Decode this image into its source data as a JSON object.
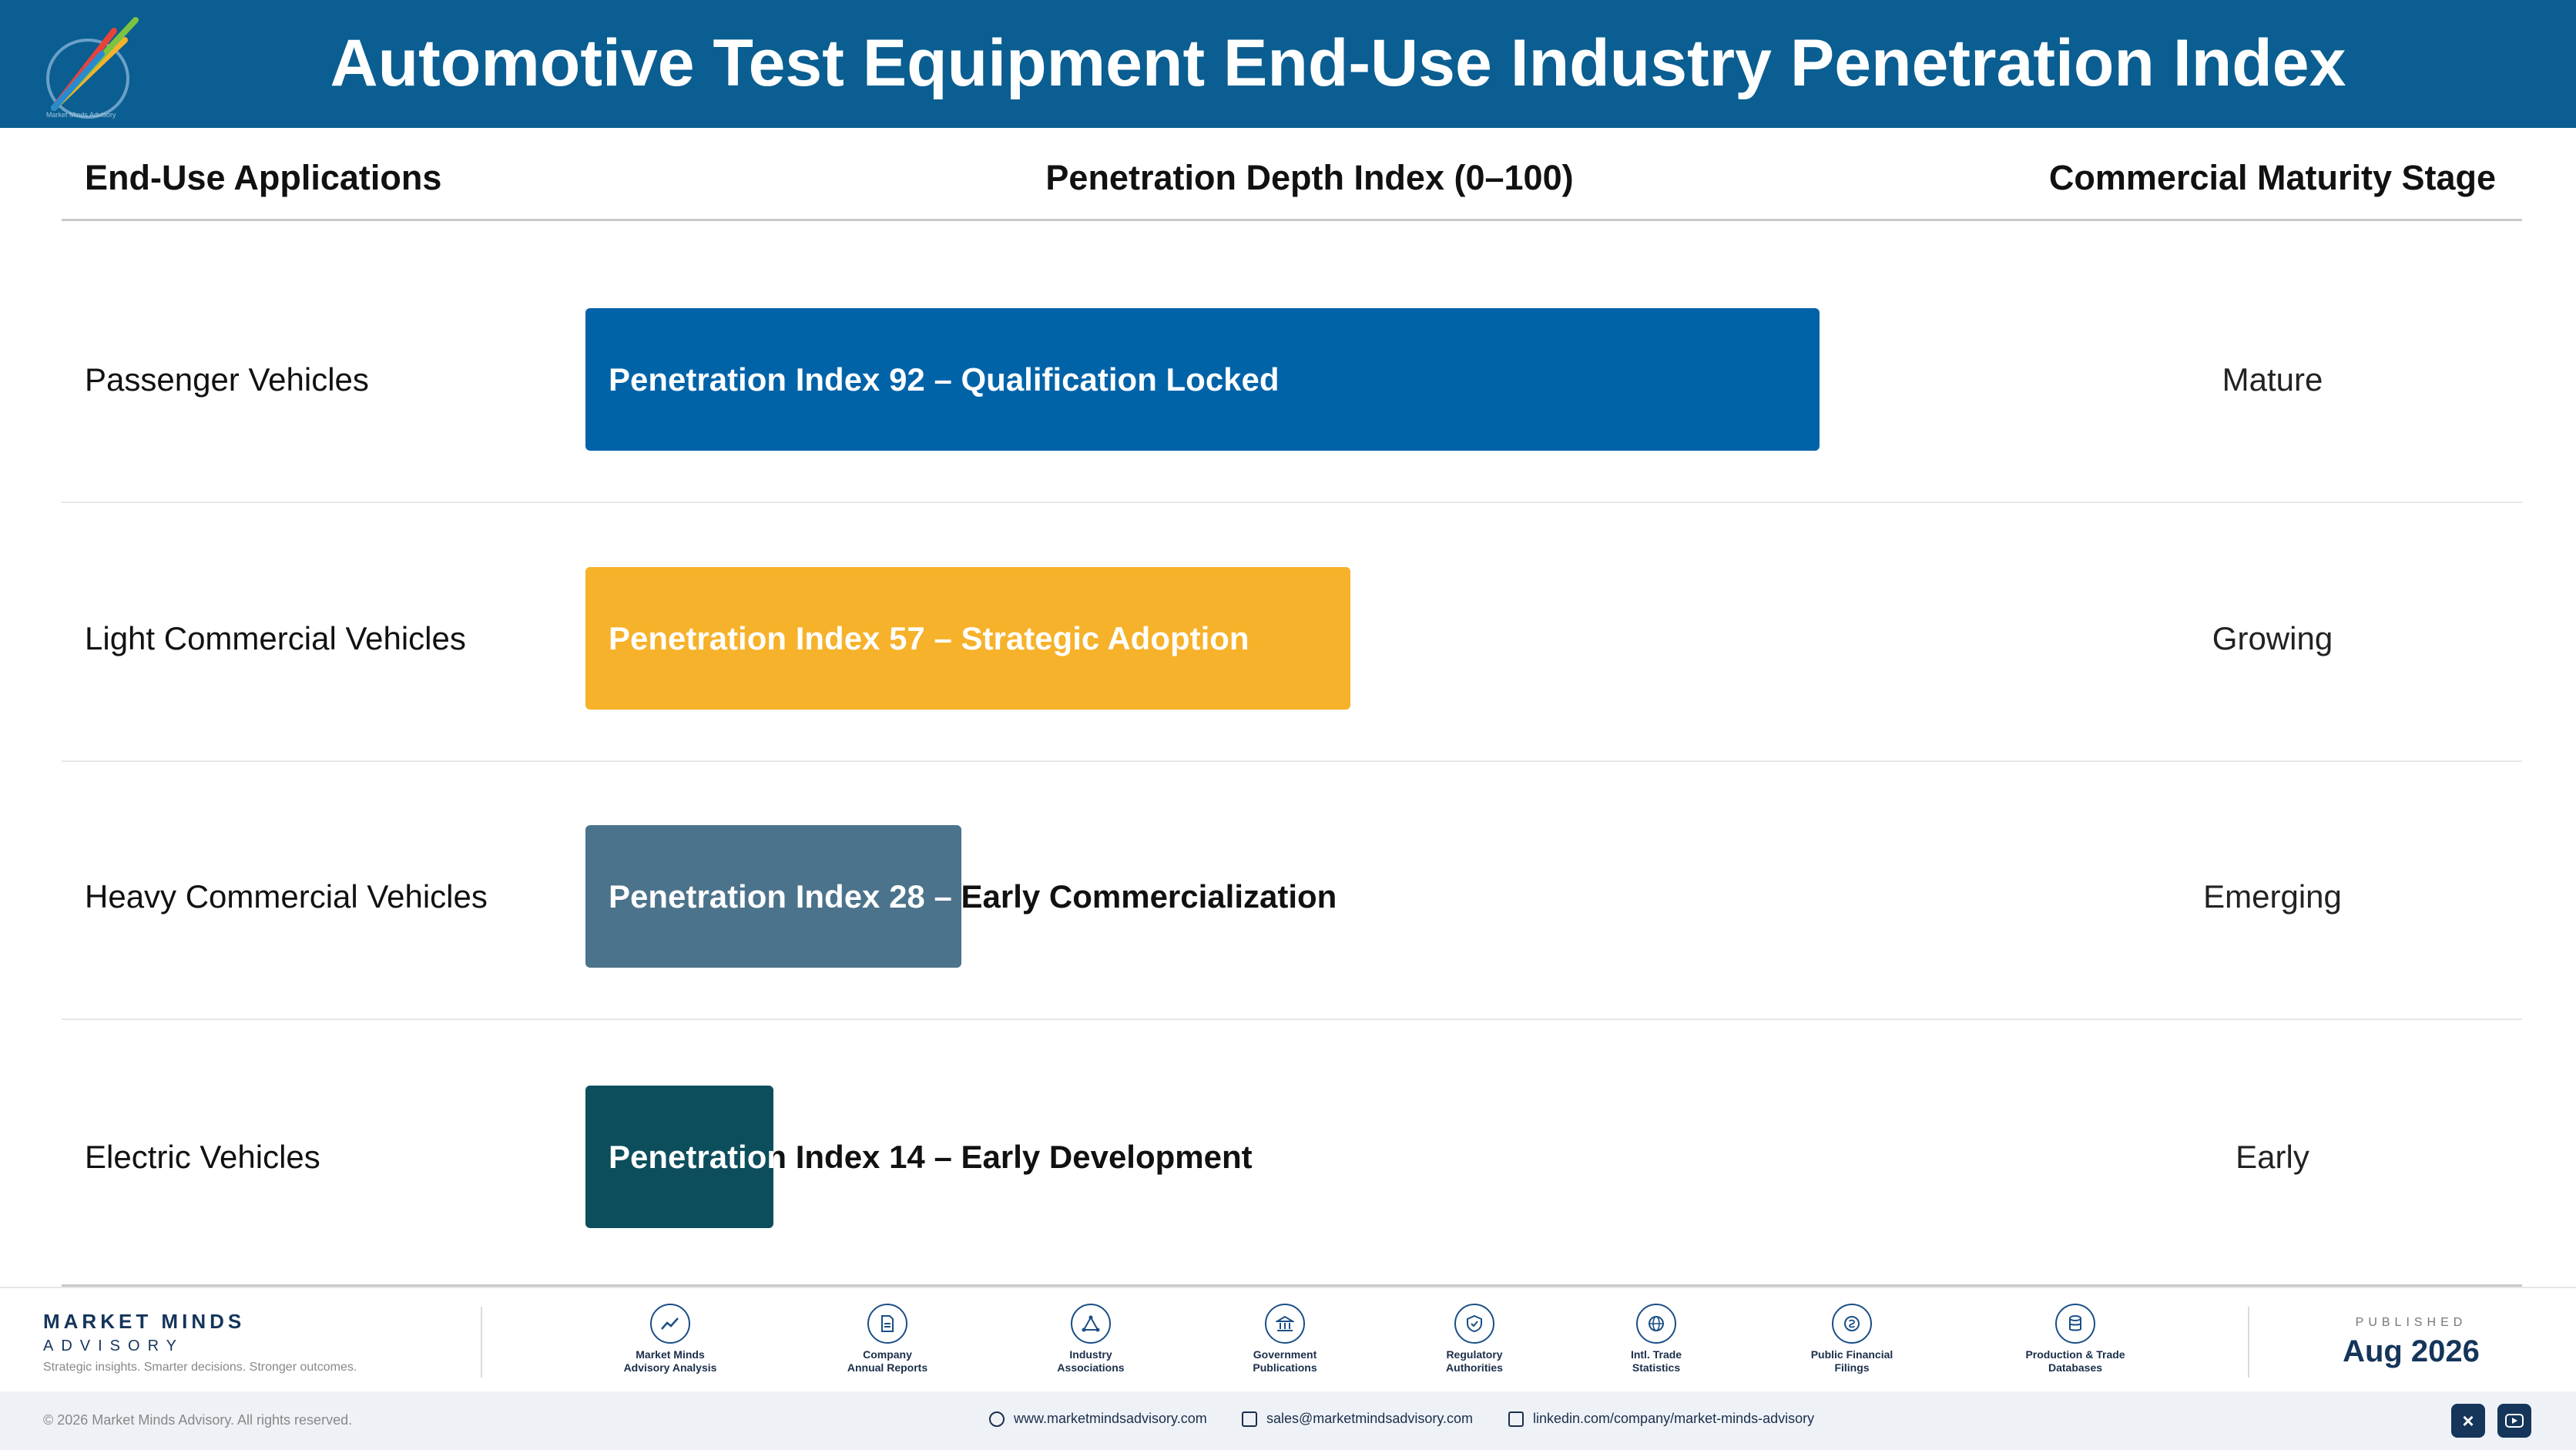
{
  "header": {
    "title": "Automotive Test Equipment End-Use Industry Penetration Index",
    "logo_icon": "pencil-burst-logo-icon",
    "logo_text": "Market Minds Advisory"
  },
  "columns": {
    "applications": "End-Use Applications",
    "depth": "Penetration Depth Index (0–100)",
    "stage": "Commercial Maturity Stage"
  },
  "chart_data": {
    "type": "bar",
    "orientation": "horizontal",
    "title": "Automotive Test Equipment End-Use Industry Penetration Index",
    "xlabel": "Penetration Depth Index (0–100)",
    "xlim": [
      0,
      100
    ],
    "grid": false,
    "categories": [
      "Passenger Vehicles",
      "Light Commercial Vehicles",
      "Heavy Commercial Vehicles",
      "Electric Vehicles"
    ],
    "values": [
      92,
      57,
      28,
      14
    ],
    "bar_labels": [
      "Penetration Index 92 – Qualification Locked",
      "Penetration Index 57 – Strategic Adoption",
      "Penetration Index 28 – Early Commercialization",
      "Penetration Index 14 – Early Development"
    ],
    "stages": [
      "Mature",
      "Growing",
      "Emerging",
      "Early"
    ],
    "colors": [
      "#0063a8",
      "#f6b22a",
      "#4b738b",
      "#0d4e5d"
    ]
  },
  "footer": {
    "brand_name": "MARKET MINDS",
    "brand_sub": "ADVISORY",
    "brand_tagline": "Strategic insights. Smarter decisions. Stronger outcomes.",
    "sources": [
      {
        "label": "Market Minds\nAdvisory Analysis",
        "icon": "trend-line-icon"
      },
      {
        "label": "Company\nAnnual Reports",
        "icon": "document-icon"
      },
      {
        "label": "Industry\nAssociations",
        "icon": "network-icon"
      },
      {
        "label": "Government\nPublications",
        "icon": "government-building-icon"
      },
      {
        "label": "Regulatory\nAuthorities",
        "icon": "shield-check-icon"
      },
      {
        "label": "Intl. Trade\nStatistics",
        "icon": "globe-icon"
      },
      {
        "label": "Public Financial\nFilings",
        "icon": "coin-icon"
      },
      {
        "label": "Production & Trade\nDatabases",
        "icon": "database-icon"
      }
    ],
    "published_label": "PUBLISHED",
    "published_value": "Aug 2026",
    "copyright": "© 2026 Market Minds Advisory. All rights reserved.",
    "website": "www.marketmindsadvisory.com",
    "email": "sales@marketmindsadvisory.com",
    "linkedin": "linkedin.com/company/market-minds-advisory",
    "social": [
      "x-icon",
      "youtube-icon"
    ]
  }
}
